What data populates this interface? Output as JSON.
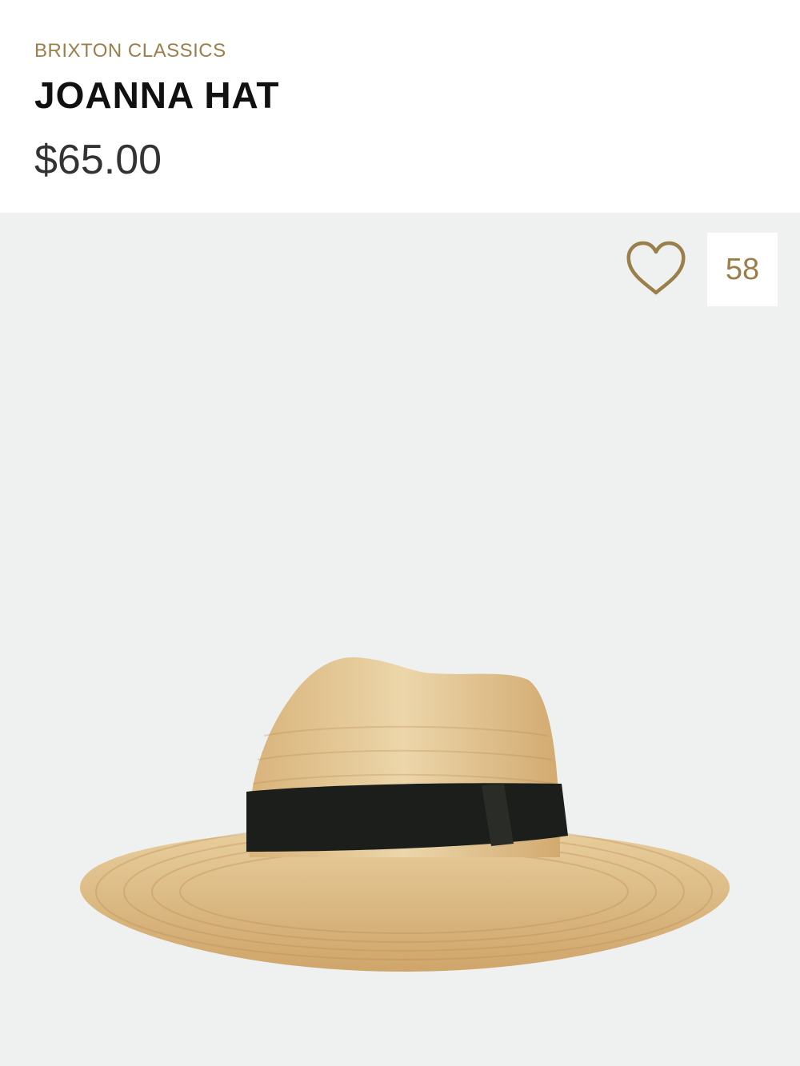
{
  "product": {
    "brand": "BRIXTON CLASSICS",
    "name": "JOANNA HAT",
    "price": "$65.00"
  },
  "favorite": {
    "icon": "heart-outline-icon",
    "count": "58"
  },
  "colors": {
    "accent": "#9a7f4a",
    "gallery_bg": "#eff1f1"
  }
}
